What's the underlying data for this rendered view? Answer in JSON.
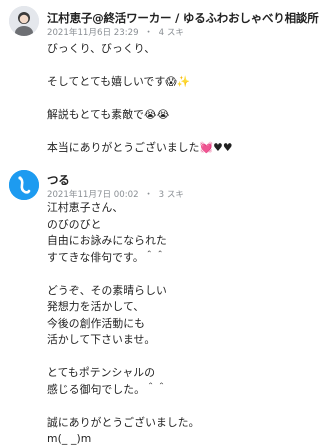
{
  "comments": [
    {
      "author": "江村恵子@終活ワーカー / ゆるふわおしゃべり相談所",
      "date": "2021年11月6日 23:29",
      "separator": "・",
      "likes": "4 スキ",
      "lines": [
        "びっくり、びっくり、",
        "",
        "そしてとても嬉しいです😱✨",
        "",
        "解説もとても素敵で😭😭",
        "",
        "本当にありがとうございました💓♥♥"
      ]
    },
    {
      "author": "つる",
      "date": "2021年11月7日 00:02",
      "separator": "・",
      "likes": "3 スキ",
      "lines": [
        "江村恵子さん、",
        "のびのびと",
        "自由にお詠みになられた",
        "すてきな俳句です。＾＾",
        "",
        "どうぞ、その素晴らしい",
        "発想力を活かして、",
        "今後の創作活動にも",
        "活かして下さいませ。",
        "",
        "とてもポテンシャルの",
        "感じる御句でした。＾＾",
        "",
        "誠にありがとうございました。",
        "m(_ _)m"
      ]
    }
  ]
}
